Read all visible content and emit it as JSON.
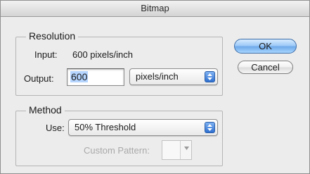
{
  "window": {
    "title": "Bitmap"
  },
  "resolution": {
    "group_title": "Resolution",
    "input_label": "Input:",
    "input_value": "600 pixels/inch",
    "output_label": "Output:",
    "output_value": "600",
    "unit_selected": "pixels/inch"
  },
  "method": {
    "group_title": "Method",
    "use_label": "Use:",
    "use_selected": "50% Threshold",
    "custom_pattern_label": "Custom Pattern:"
  },
  "buttons": {
    "ok": "OK",
    "cancel": "Cancel"
  },
  "icons": {
    "stepper": "stepper-arrows-icon",
    "dropdown": "chevron-down-icon"
  },
  "colors": {
    "accent": "#3f7fe0",
    "default_button": "#8fc3f5"
  }
}
